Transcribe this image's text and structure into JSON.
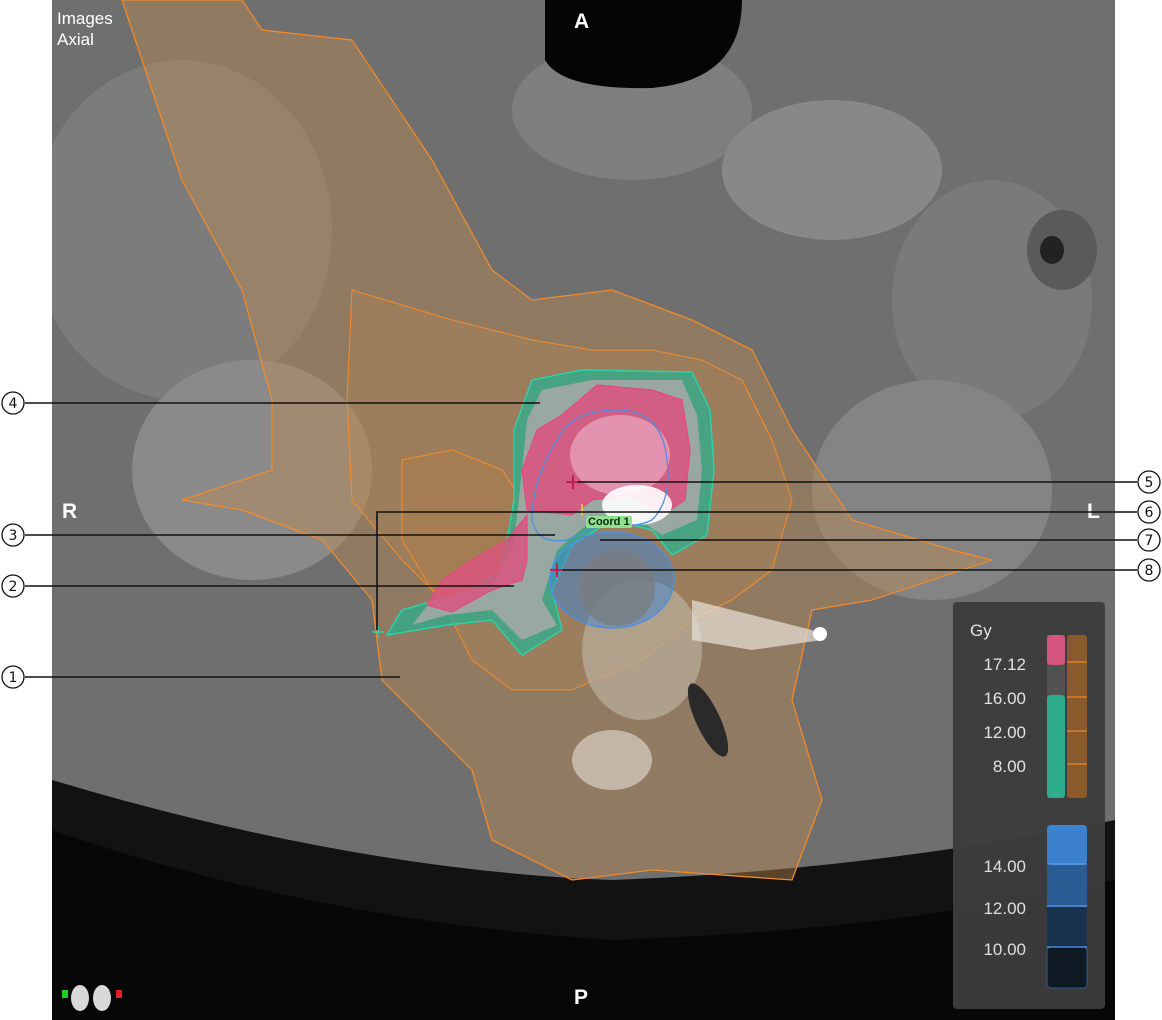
{
  "view": {
    "title_line1": "Images",
    "title_line2": "Axial"
  },
  "orientation": {
    "anterior": "A",
    "posterior": "P",
    "right": "R",
    "left": "L"
  },
  "coord_label": "Coord 1",
  "legend": {
    "unit": "Gy",
    "dose_values": [
      "17.12",
      "16.00",
      "12.00",
      "8.00"
    ],
    "dose_colors": [
      "#d9557f",
      "#505050",
      "#2bb08e",
      "#c58a3b"
    ],
    "secondary_values": [
      "14.00",
      "12.00",
      "10.00"
    ],
    "secondary_color": "#3d86d6"
  },
  "callouts": [
    "1",
    "2",
    "3",
    "4",
    "5",
    "6",
    "7",
    "8"
  ],
  "icons": {
    "patient": "patient-orientation-icon"
  }
}
